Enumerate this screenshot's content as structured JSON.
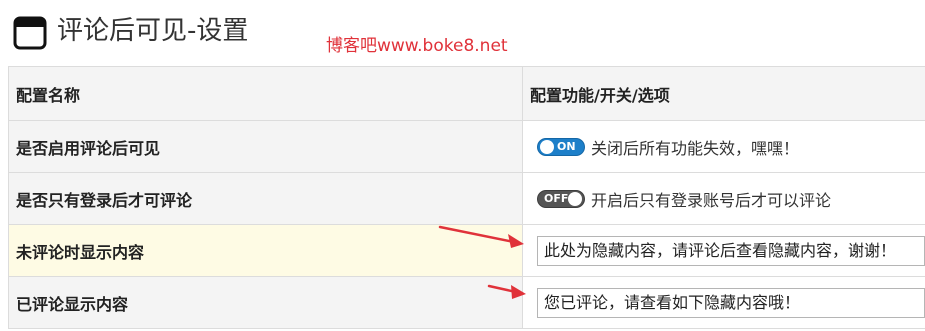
{
  "header": {
    "title": "评论后可见-设置",
    "watermark": "博客吧www.boke8.net"
  },
  "table": {
    "columns": {
      "name": "配置名称",
      "value": "配置功能/开关/选项"
    },
    "rows": [
      {
        "label": "是否启用评论后可见",
        "toggle_state": "on",
        "toggle_label": "ON",
        "description": "关闭后所有功能失效，嘿嘿！"
      },
      {
        "label": "是否只有登录后才可评论",
        "toggle_state": "off",
        "toggle_label": "OFF",
        "description": "开启后只有登录账号后才可以评论"
      },
      {
        "label": "未评论时显示内容",
        "value": "此处为隐藏内容，请评论后查看隐藏内容，谢谢！"
      },
      {
        "label": "已评论显示内容",
        "value": "您已评论，请查看如下隐藏内容哦！"
      }
    ]
  },
  "colors": {
    "toggle_on": "#1d7fc9",
    "toggle_off": "#555555",
    "annotation_arrow": "#e0323a",
    "highlight_row": "#fefbe4"
  }
}
